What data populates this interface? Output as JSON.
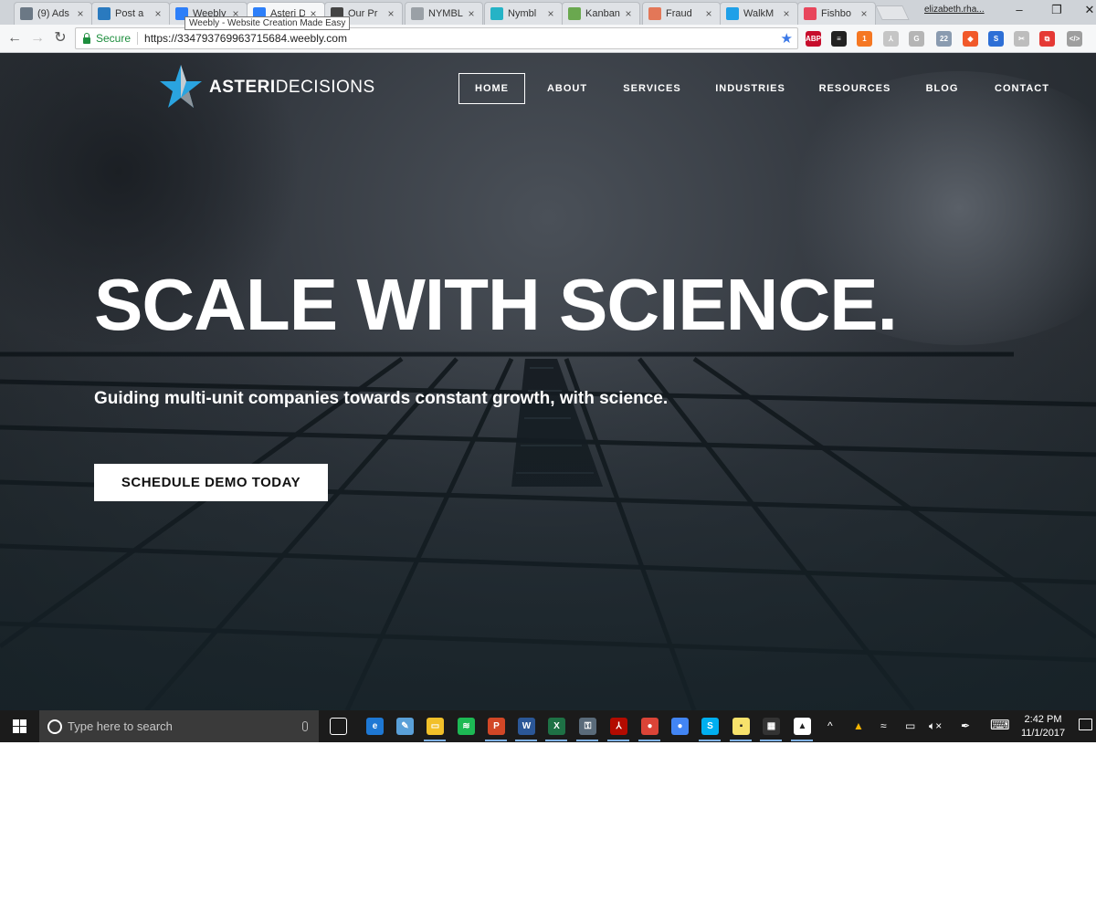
{
  "browser": {
    "tabs": [
      {
        "title": "(9) Ads",
        "icon": "facebook-icon",
        "color": "#6b7885",
        "active": false
      },
      {
        "title": "Post a",
        "icon": "sunburst-icon",
        "color": "#2a7abf",
        "active": false
      },
      {
        "title": "Weebly",
        "icon": "weebly-icon",
        "color": "#2d7ff9",
        "active": false
      },
      {
        "title": "Asteri D",
        "icon": "weebly-icon",
        "color": "#2d7ff9",
        "active": true
      },
      {
        "title": "Our Pr",
        "icon": "nodes-icon",
        "color": "#444444",
        "active": false
      },
      {
        "title": "NYMBL",
        "icon": "page-icon",
        "color": "#9aa0a6",
        "active": false
      },
      {
        "title": "Nymbl",
        "icon": "wave-icon",
        "color": "#25b3c6",
        "active": false
      },
      {
        "title": "Kanban",
        "icon": "play-icon",
        "color": "#6aa84f",
        "active": false
      },
      {
        "title": "Fraud",
        "icon": "bubbles-icon",
        "color": "#e37758",
        "active": false
      },
      {
        "title": "WalkM",
        "icon": "w-circle-icon",
        "color": "#1fa0e8",
        "active": false
      },
      {
        "title": "Fishbo",
        "icon": "stripes-icon",
        "color": "#e8465c",
        "active": false
      }
    ],
    "tab_close": "×",
    "tooltip": "Weebly - Website Creation Made Easy",
    "profile_name": "elizabeth.rha...",
    "window_controls": {
      "minimize": "–",
      "restore": "❐",
      "close": "✕"
    },
    "nav": {
      "back": "←",
      "forward": "→",
      "reload": "↻"
    },
    "security_label": "Secure",
    "url": "https://334793769963715684.weebly.com",
    "bookmark_star": "★",
    "extensions": [
      {
        "name": "adblock-plus-icon",
        "label": "ABP",
        "color": "#c70d2c"
      },
      {
        "name": "buffer-icon",
        "label": "≡",
        "color": "#222222"
      },
      {
        "name": "hubspot-icon",
        "label": "1",
        "color": "#f57722"
      },
      {
        "name": "pdf-icon",
        "label": "⅄",
        "color": "#c5c5c5"
      },
      {
        "name": "grammar-icon",
        "label": "G",
        "color": "#b5b5b5"
      },
      {
        "name": "ext-counter-icon",
        "label": "22",
        "color": "#8a9bb0"
      },
      {
        "name": "puzzle-icon",
        "label": "◆",
        "color": "#f1592a"
      },
      {
        "name": "skype-ext-icon",
        "label": "S",
        "color": "#2d6fd6"
      },
      {
        "name": "tools-icon",
        "label": "✂",
        "color": "#bdbdbd"
      },
      {
        "name": "screencast-icon",
        "label": "⧉",
        "color": "#e53935"
      },
      {
        "name": "code-icon",
        "label": "</>",
        "color": "#9e9e9e"
      }
    ]
  },
  "site": {
    "logo_bold": "ASTERI",
    "logo_light": "DECISIONS",
    "nav": [
      "HOME",
      "ABOUT",
      "SERVICES",
      "INDUSTRIES",
      "RESOURCES",
      "BLOG",
      "CONTACT"
    ],
    "active_nav": "HOME",
    "hero_title": "SCALE WITH SCIENCE.",
    "hero_subtitle": "Guiding multi-unit companies towards constant growth, with science.",
    "cta_label": "SCHEDULE DEMO TODAY",
    "colors": {
      "logo_star": "#2aa4e0",
      "cta_bg": "#ffffff",
      "cta_text": "#111111"
    }
  },
  "taskbar": {
    "search_placeholder": "Type here to search",
    "apps": [
      {
        "name": "task-view-icon",
        "label": "⧠",
        "color": "transparent",
        "running": false
      },
      {
        "name": "edge-icon",
        "label": "e",
        "color": "#1e78d4",
        "running": false
      },
      {
        "name": "paint-icon",
        "label": "✎",
        "color": "#5aa0d8",
        "running": false
      },
      {
        "name": "file-explorer-icon",
        "label": "▭",
        "color": "#f2c029",
        "running": true
      },
      {
        "name": "spotify-icon",
        "label": "≋",
        "color": "#1db954",
        "running": false
      },
      {
        "name": "powerpoint-icon",
        "label": "P",
        "color": "#d24726",
        "running": true
      },
      {
        "name": "word-icon",
        "label": "W",
        "color": "#2b5797",
        "running": true
      },
      {
        "name": "excel-icon",
        "label": "X",
        "color": "#1e7145",
        "running": true
      },
      {
        "name": "keepass-icon",
        "label": "⚿",
        "color": "#5a6b7a",
        "running": true
      },
      {
        "name": "acrobat-icon",
        "label": "⅄",
        "color": "#b30b00",
        "running": true
      },
      {
        "name": "chrome-user-icon",
        "label": "●",
        "color": "#db4437",
        "running": true
      },
      {
        "name": "chrome-icon",
        "label": "●",
        "color": "#4285f4",
        "running": false
      },
      {
        "name": "skype-icon",
        "label": "S",
        "color": "#00aff0",
        "running": true
      },
      {
        "name": "sticky-notes-icon",
        "label": "▪",
        "color": "#f7e26b",
        "running": true
      },
      {
        "name": "calculator-icon",
        "label": "▦",
        "color": "#333333",
        "running": true
      },
      {
        "name": "photos-icon",
        "label": "▲",
        "color": "#ffffff",
        "running": true
      }
    ],
    "tray": {
      "chevron": "^",
      "drive": "▲",
      "wifi": "≈",
      "battery": "▭",
      "volume": "🔈︎×",
      "pen": "✒",
      "keyboard": "⌨"
    },
    "time": "2:42 PM",
    "date": "11/1/2017"
  }
}
